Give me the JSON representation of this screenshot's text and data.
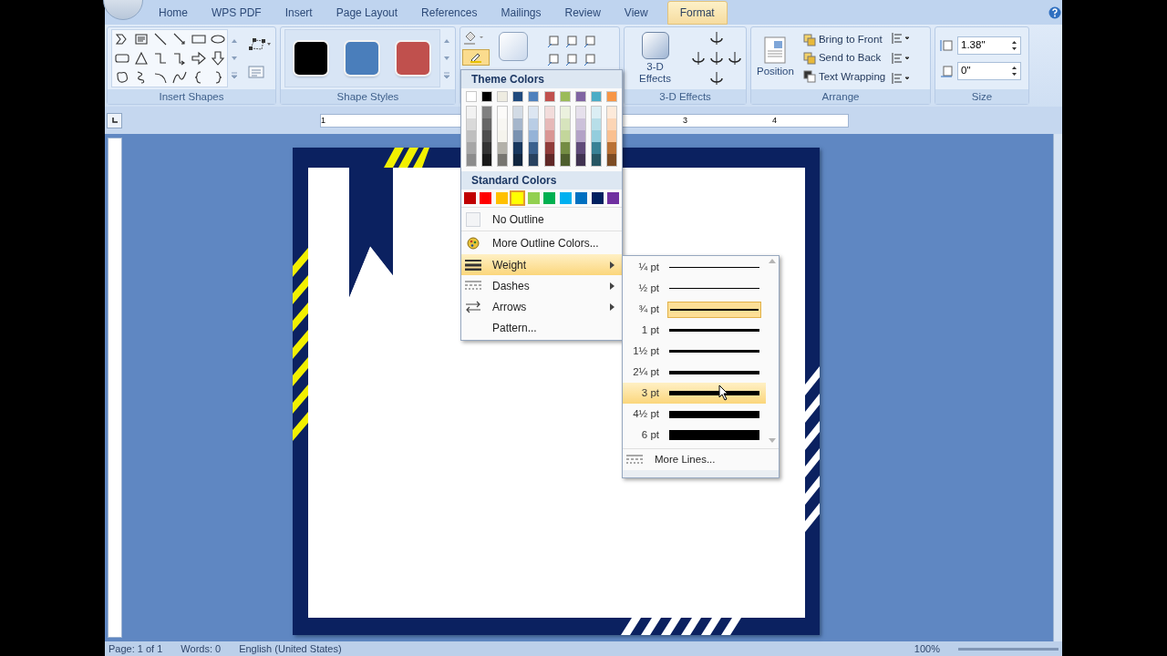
{
  "tabs": [
    {
      "label": "Home",
      "selected": false
    },
    {
      "label": "WPS PDF",
      "selected": false
    },
    {
      "label": "Insert",
      "selected": false
    },
    {
      "label": "Page Layout",
      "selected": false
    },
    {
      "label": "References",
      "selected": false
    },
    {
      "label": "Mailings",
      "selected": false
    },
    {
      "label": "Review",
      "selected": false
    },
    {
      "label": "View",
      "selected": false
    },
    {
      "label": "Format",
      "selected": true
    }
  ],
  "ribbon": {
    "insert_shapes": {
      "label": "Insert Shapes"
    },
    "shape_styles": {
      "label": "Shape Styles",
      "swatches": [
        {
          "color": "#000000"
        },
        {
          "color": "#4a7ebb"
        },
        {
          "color": "#c0504d"
        }
      ]
    },
    "three_d": {
      "button": "3-D Effects",
      "label": "3-D Effects"
    },
    "arrange": {
      "position": "Position",
      "bring_to_front": "Bring to Front",
      "send_to_back": "Send to Back",
      "text_wrapping": "Text Wrapping",
      "label": "Arrange"
    },
    "size": {
      "height": "1.38\"",
      "width": "0\"",
      "label": "Size"
    }
  },
  "ruler": [
    "1",
    "3",
    "4"
  ],
  "outline_menu": {
    "theme_title": "Theme Colors",
    "theme_colors": [
      {
        "color": "#ffffff"
      },
      {
        "color": "#000000"
      },
      {
        "color": "#eeece1"
      },
      {
        "color": "#1f497d"
      },
      {
        "color": "#4f81bd"
      },
      {
        "color": "#c0504d"
      },
      {
        "color": "#9bbb59"
      },
      {
        "color": "#8064a2"
      },
      {
        "color": "#4bacc6"
      },
      {
        "color": "#f79646"
      }
    ],
    "standard_title": "Standard Colors",
    "standard_colors": [
      {
        "color": "#c00000",
        "selected": false
      },
      {
        "color": "#ff0000",
        "selected": false
      },
      {
        "color": "#ffc000",
        "selected": false
      },
      {
        "color": "#ffff00",
        "selected": true
      },
      {
        "color": "#92d050",
        "selected": false
      },
      {
        "color": "#00b050",
        "selected": false
      },
      {
        "color": "#00b0f0",
        "selected": false
      },
      {
        "color": "#0070c0",
        "selected": false
      },
      {
        "color": "#002060",
        "selected": false
      },
      {
        "color": "#7030a0",
        "selected": false
      }
    ],
    "items": [
      {
        "kind": "none",
        "label": "No Outline",
        "selected": false,
        "submenu": false
      },
      {
        "kind": "palette",
        "label": "More Outline Colors...",
        "selected": false,
        "submenu": false
      },
      {
        "kind": "weight",
        "label": "Weight",
        "selected": true,
        "submenu": true
      },
      {
        "kind": "dashes",
        "label": "Dashes",
        "selected": false,
        "submenu": true
      },
      {
        "kind": "arrows",
        "label": "Arrows",
        "selected": false,
        "submenu": true
      },
      {
        "kind": "plain",
        "label": "Pattern...",
        "selected": false,
        "submenu": false
      }
    ]
  },
  "weight_menu": {
    "items": [
      {
        "label": "¼ pt",
        "checked": false,
        "selected": false
      },
      {
        "label": "½ pt",
        "checked": false,
        "selected": false
      },
      {
        "label": "¾ pt",
        "checked": true,
        "selected": false
      },
      {
        "label": "1 pt",
        "checked": false,
        "selected": false
      },
      {
        "label": "1½ pt",
        "checked": false,
        "selected": false
      },
      {
        "label": "2¼ pt",
        "checked": false,
        "selected": false
      },
      {
        "label": "3 pt",
        "checked": false,
        "selected": true
      },
      {
        "label": "4½ pt",
        "checked": false,
        "selected": false
      },
      {
        "label": "6 pt",
        "checked": false,
        "selected": false
      }
    ],
    "more": "More Lines..."
  },
  "status_bar": {
    "page": "Page: 1 of 1",
    "words": "Words: 0",
    "language": "English (United States)",
    "zoom": "100%"
  }
}
